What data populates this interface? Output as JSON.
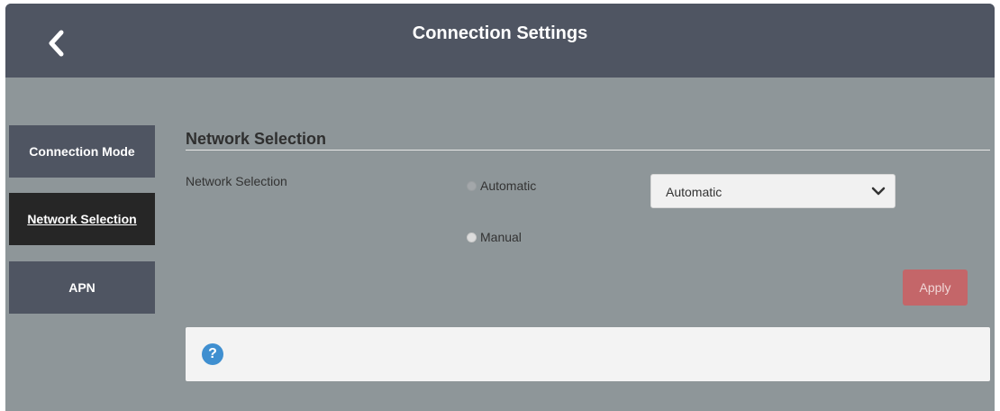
{
  "header": {
    "title": "Connection Settings",
    "back_icon": "chevron-left-icon"
  },
  "sidebar": {
    "items": [
      {
        "label": "Connection Mode",
        "active": false
      },
      {
        "label": "Network Selection",
        "active": true
      },
      {
        "label": "APN",
        "active": false
      }
    ]
  },
  "main": {
    "section_title": "Network Selection",
    "field_label": "Network Selection",
    "radio_options": [
      {
        "label": "Automatic",
        "selected": true
      },
      {
        "label": "Manual",
        "selected": false
      }
    ],
    "select": {
      "value": "Automatic",
      "icon": "chevron-down-icon"
    },
    "apply_label": "Apply",
    "help": {
      "icon": "help-icon",
      "glyph": "?"
    }
  },
  "colors": {
    "header_bg": "#4f5562",
    "page_bg": "#8e9699",
    "active_nav_bg": "#262626",
    "apply_bg": "#c46669",
    "help_icon_bg": "#3f8fd0"
  }
}
